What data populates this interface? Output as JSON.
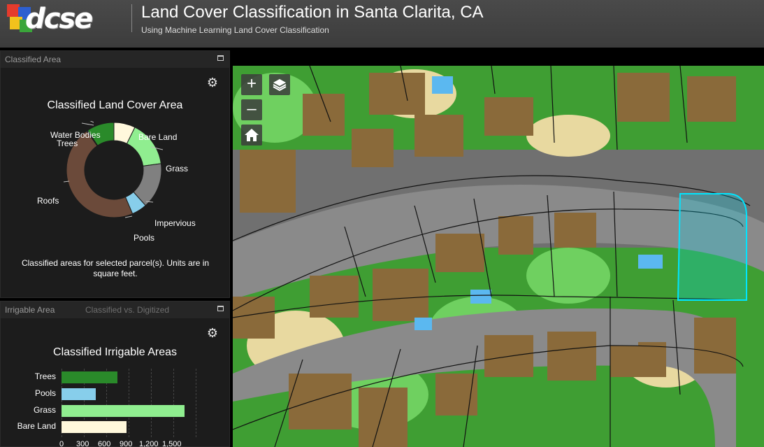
{
  "header": {
    "logo_text": "dcse",
    "title": "Land Cover Classification in Santa Clarita, CA",
    "subtitle": "Using Machine Learning Land Cover Classification"
  },
  "panel_classified": {
    "tab_label": "Classified Area",
    "chart_title": "Classified Land Cover Area",
    "caption": "Classified areas for selected parcel(s). Units are in square feet."
  },
  "panel_irrigable": {
    "tab_label": "Irrigable Area",
    "tab2_label": "Classified vs. Digitized",
    "chart_title": "Classified Irrigable Areas"
  },
  "map_controls": {
    "zoom_in": "+",
    "zoom_out": "–"
  },
  "icons": {
    "gear": "gear-icon",
    "layers": "layers-icon",
    "home": "home-icon",
    "maximize": "maximize-icon"
  },
  "colors": {
    "trees": "#2a8a2a",
    "bare_land": "#fff8dc",
    "grass": "#90ee90",
    "impervious": "#808080",
    "pools": "#87ceeb",
    "roofs": "#6b4a3a",
    "water_bodies": "#3366cc",
    "selection": "#00e5ff"
  },
  "chart_data": [
    {
      "type": "pie",
      "title": "Classified Land Cover Area",
      "categories": [
        "Bare Land",
        "Grass",
        "Impervious",
        "Pools",
        "Roofs",
        "Water Bodies",
        "Trees"
      ],
      "values": [
        7,
        15,
        15,
        5,
        45,
        0.3,
        9
      ],
      "colors": [
        "#fff8dc",
        "#90ee90",
        "#808080",
        "#87ceeb",
        "#6b4a3a",
        "#3366cc",
        "#2a8a2a"
      ]
    },
    {
      "type": "bar",
      "title": "Classified Irrigable Areas",
      "categories": [
        "Trees",
        "Pools",
        "Grass",
        "Bare Land"
      ],
      "values": [
        750,
        460,
        1650,
        870
      ],
      "colors": [
        "#2a8a2a",
        "#87ceeb",
        "#90ee90",
        "#fff8dc"
      ],
      "xlim": [
        0,
        1800
      ],
      "x_ticks": [
        "0",
        "300",
        "600",
        "900",
        "1,200",
        "1,500"
      ],
      "grid": true
    }
  ]
}
